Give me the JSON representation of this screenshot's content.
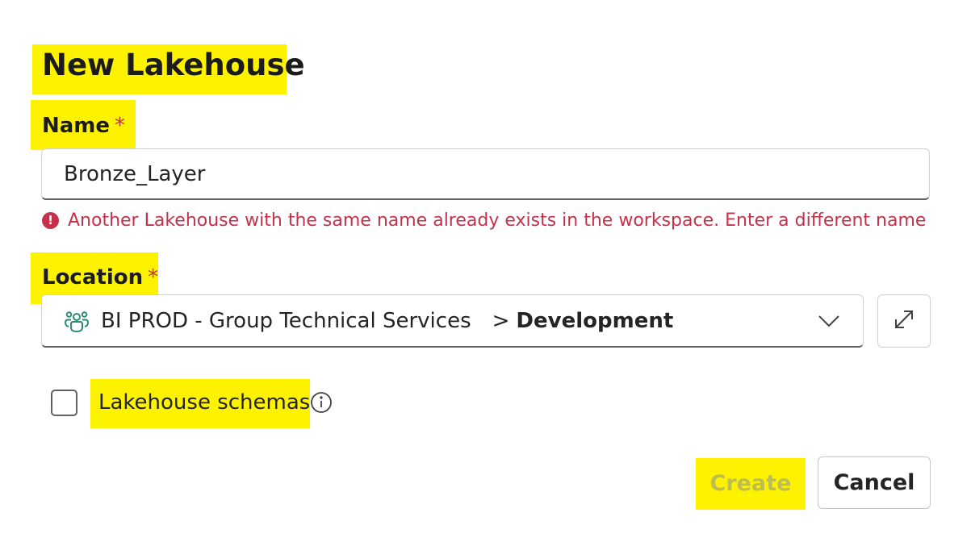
{
  "dialog": {
    "title": "New Lakehouse"
  },
  "name_field": {
    "label": "Name",
    "required_mark": "*",
    "value": "Bronze_Layer",
    "error_icon_text": "!",
    "error_message": "Another Lakehouse with the same name already exists in the workspace. Enter a different name"
  },
  "location_field": {
    "label": "Location",
    "required_mark": "*",
    "workspace_icon": "people-group-icon",
    "workspace_name": "BI PROD - Group Technical Services",
    "separator": ">",
    "folder": "Development",
    "dropdown_icon": "chevron-down-icon",
    "expand_icon": "expand-arrow-icon"
  },
  "schemas_option": {
    "label": "Lakehouse schemas",
    "checked": false,
    "info_icon": "info-icon"
  },
  "buttons": {
    "create": "Create",
    "cancel": "Cancel"
  },
  "colors": {
    "highlight": "#fdf200",
    "error": "#c4314b",
    "workspace_icon": "#2e8a78"
  }
}
